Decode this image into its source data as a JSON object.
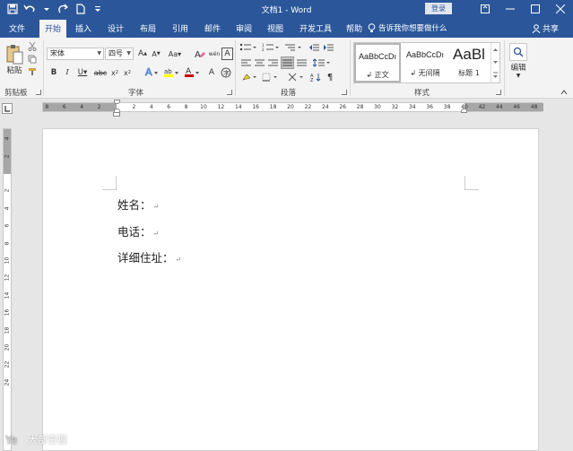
{
  "window": {
    "title": "文档1 - Word",
    "login_label": "登录"
  },
  "tabs": [
    {
      "label": "文件"
    },
    {
      "label": "开始"
    },
    {
      "label": "插入"
    },
    {
      "label": "设计"
    },
    {
      "label": "布局"
    },
    {
      "label": "引用"
    },
    {
      "label": "邮件"
    },
    {
      "label": "审阅"
    },
    {
      "label": "视图"
    },
    {
      "label": "开发工具"
    },
    {
      "label": "帮助"
    }
  ],
  "tell_me_placeholder": "告诉我你想要做什么",
  "share_label": "共享",
  "ribbon": {
    "clipboard": {
      "paste_label": "粘贴",
      "group_label": "剪贴板"
    },
    "font": {
      "font_name": "宋体",
      "font_size": "四号",
      "group_label": "字体"
    },
    "paragraph": {
      "group_label": "段落"
    },
    "styles": {
      "group_label": "样式",
      "items": [
        {
          "sample": "AaBbCcDı",
          "name": "↲ 正文"
        },
        {
          "sample": "AaBbCcDı",
          "name": "↲ 无间隔"
        },
        {
          "sample": "AaBl",
          "name": "标题 1"
        }
      ]
    },
    "editing": {
      "label": "编辑"
    }
  },
  "ruler": {
    "h_ticks": [
      "8",
      "6",
      "4",
      "2",
      "2",
      "4",
      "6",
      "8",
      "10",
      "12",
      "14",
      "16",
      "18",
      "20",
      "22",
      "24",
      "26",
      "28",
      "30",
      "32",
      "34",
      "36",
      "38",
      "40",
      "42",
      "44",
      "46",
      "48"
    ],
    "v_ticks": [
      "4",
      "2",
      "2",
      "4",
      "6",
      "8",
      "10",
      "12",
      "14",
      "16",
      "18",
      "20",
      "22",
      "24"
    ]
  },
  "document": {
    "lines": [
      "姓名：",
      "电话：",
      "详细住址："
    ],
    "para_mark": "↵"
  },
  "watermark_text": "大部穷猩",
  "colors": {
    "accent": "#2b579a",
    "ribbon_bg": "#f3f3f3"
  }
}
